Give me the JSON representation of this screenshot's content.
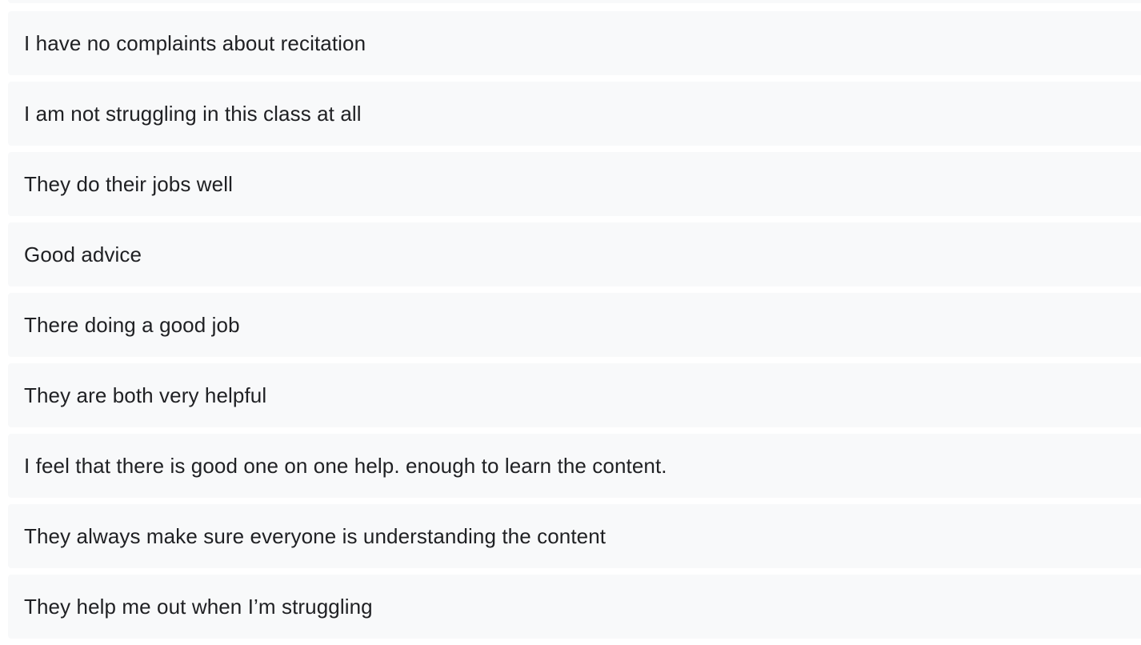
{
  "responses": [
    "I have no complaints about recitation",
    "I am not struggling in this class at all",
    "They do their jobs well",
    "Good advice",
    "There doing a good job",
    "They are both very helpful",
    "I feel that there is good one on one help. enough to learn the content.",
    "They always make sure everyone is understanding the content",
    "They help me out when I’m struggling"
  ],
  "colors": {
    "item_background": "#f8f9fa",
    "text": "#202124",
    "page_background": "#ffffff"
  }
}
